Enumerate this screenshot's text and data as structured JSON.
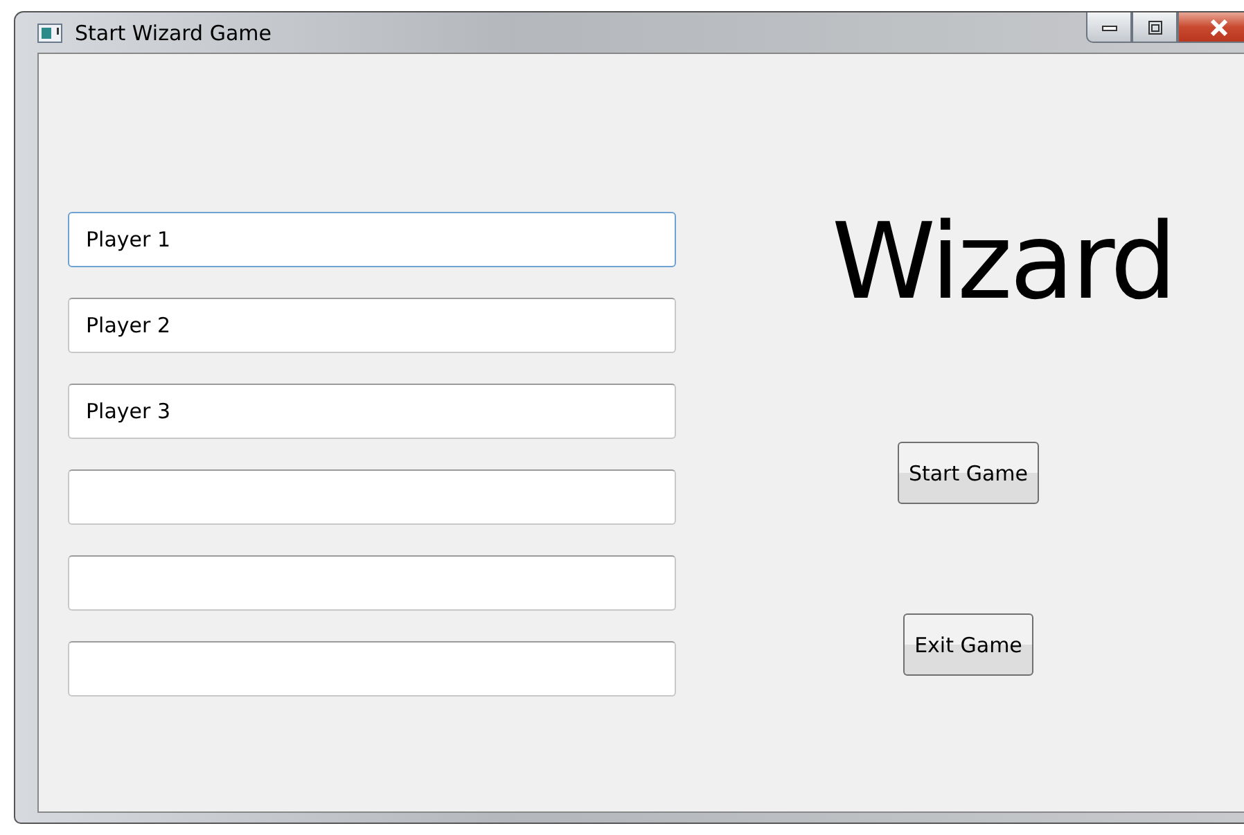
{
  "window": {
    "title": "Start Wizard Game"
  },
  "player_fields": [
    {
      "value": "Player 1",
      "focused": true
    },
    {
      "value": "Player 2",
      "focused": false
    },
    {
      "value": "Player 3",
      "focused": false
    },
    {
      "focused": false
    },
    {
      "focused": false
    },
    {
      "focused": false
    }
  ],
  "heading": "Wizard",
  "buttons": [
    {
      "label": "Start Game"
    },
    {
      "label": "Exit Game"
    }
  ]
}
